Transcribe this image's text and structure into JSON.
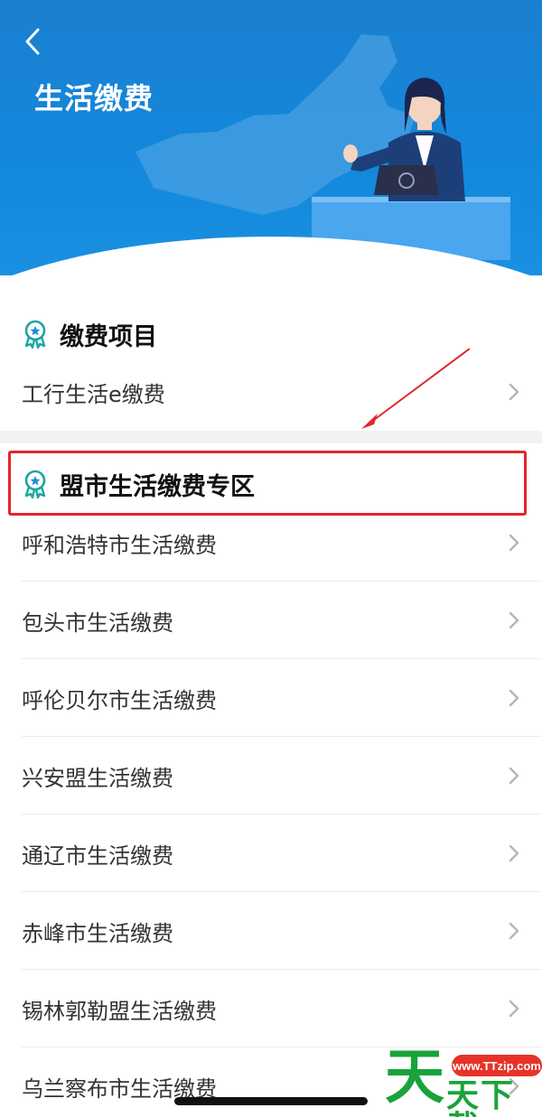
{
  "header": {
    "title": "生活缴费",
    "back_icon": "chevron-left-icon",
    "bg_color": "#1388dc"
  },
  "sections": {
    "payment_items": {
      "title": "缴费项目",
      "icon": "award-ribbon-icon",
      "items": [
        {
          "label": "工行生活e缴费"
        }
      ]
    },
    "league_zone": {
      "title": "盟市生活缴费专区",
      "icon": "award-ribbon-icon",
      "highlight_color": "#e0262e",
      "items": [
        {
          "label": "呼和浩特市生活缴费"
        },
        {
          "label": "包头市生活缴费"
        },
        {
          "label": "呼伦贝尔市生活缴费"
        },
        {
          "label": "兴安盟生活缴费"
        },
        {
          "label": "通辽市生活缴费"
        },
        {
          "label": "赤峰市生活缴费"
        },
        {
          "label": "锡林郭勒盟生活缴费"
        },
        {
          "label": "乌兰察布市生活缴费"
        }
      ]
    }
  },
  "row_chevron_icon": "chevron-right-icon",
  "watermark": {
    "url_text": "www.TTzip.com",
    "big_char": "天",
    "small_text": "天下载"
  }
}
